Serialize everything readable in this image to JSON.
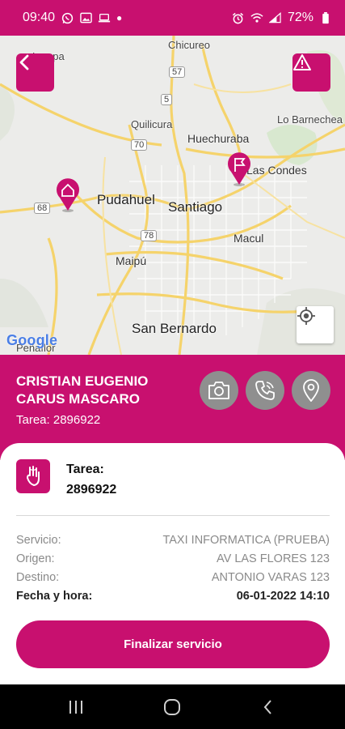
{
  "status_bar": {
    "time": "09:40",
    "battery": "72%",
    "left_icons": [
      "whatsapp-icon",
      "gallery-icon",
      "laptop-icon",
      "dot"
    ],
    "right_icons": [
      "alarm-icon",
      "wifi-icon",
      "signal-icon",
      "battery-icon"
    ]
  },
  "map": {
    "labels": {
      "chicureo": "Chicureo",
      "quilicura": "Quilicura",
      "huechuraba": "Huechuraba",
      "lo_barnechea": "Lo Barnechea",
      "las_condes": "Las Condes",
      "pudahuel": "Pudahuel",
      "santiago": "Santiago",
      "macul": "Macul",
      "maipu": "Maipú",
      "san_bernardo": "San Bernardo",
      "penaflor": "Peñaflor",
      "lampa": "Lampa"
    },
    "route_shields": {
      "r57": "57",
      "r5": "5",
      "r70": "70",
      "r68": "68",
      "r78": "78"
    },
    "attribution": "Google",
    "back_button_icon": "chevron-left-icon",
    "alert_button_icon": "warning-triangle-icon",
    "locate_button_icon": "my-location-icon"
  },
  "passenger": {
    "name": "CRISTIAN EUGENIO CARUS MASCARO",
    "task_line": "Tarea: 2896922",
    "actions": [
      "camera-icon",
      "phone-icon",
      "location-pin-icon"
    ]
  },
  "card": {
    "task_label": "Tarea:",
    "task_number": "2896922",
    "rows": {
      "servicio": {
        "label": "Servicio:",
        "value": "TAXI INFORMATICA (PRUEBA)"
      },
      "origen": {
        "label": "Origen:",
        "value": "AV LAS FLORES 123"
      },
      "destino": {
        "label": "Destino:",
        "value": "ANTONIO VARAS 123"
      },
      "fecha": {
        "label": "Fecha y hora:",
        "value": "06-01-2022 14:10"
      }
    },
    "finish_button": "Finalizar servicio"
  },
  "colors": {
    "brand": "#c8106f",
    "action_gray": "#8f8f8f"
  }
}
